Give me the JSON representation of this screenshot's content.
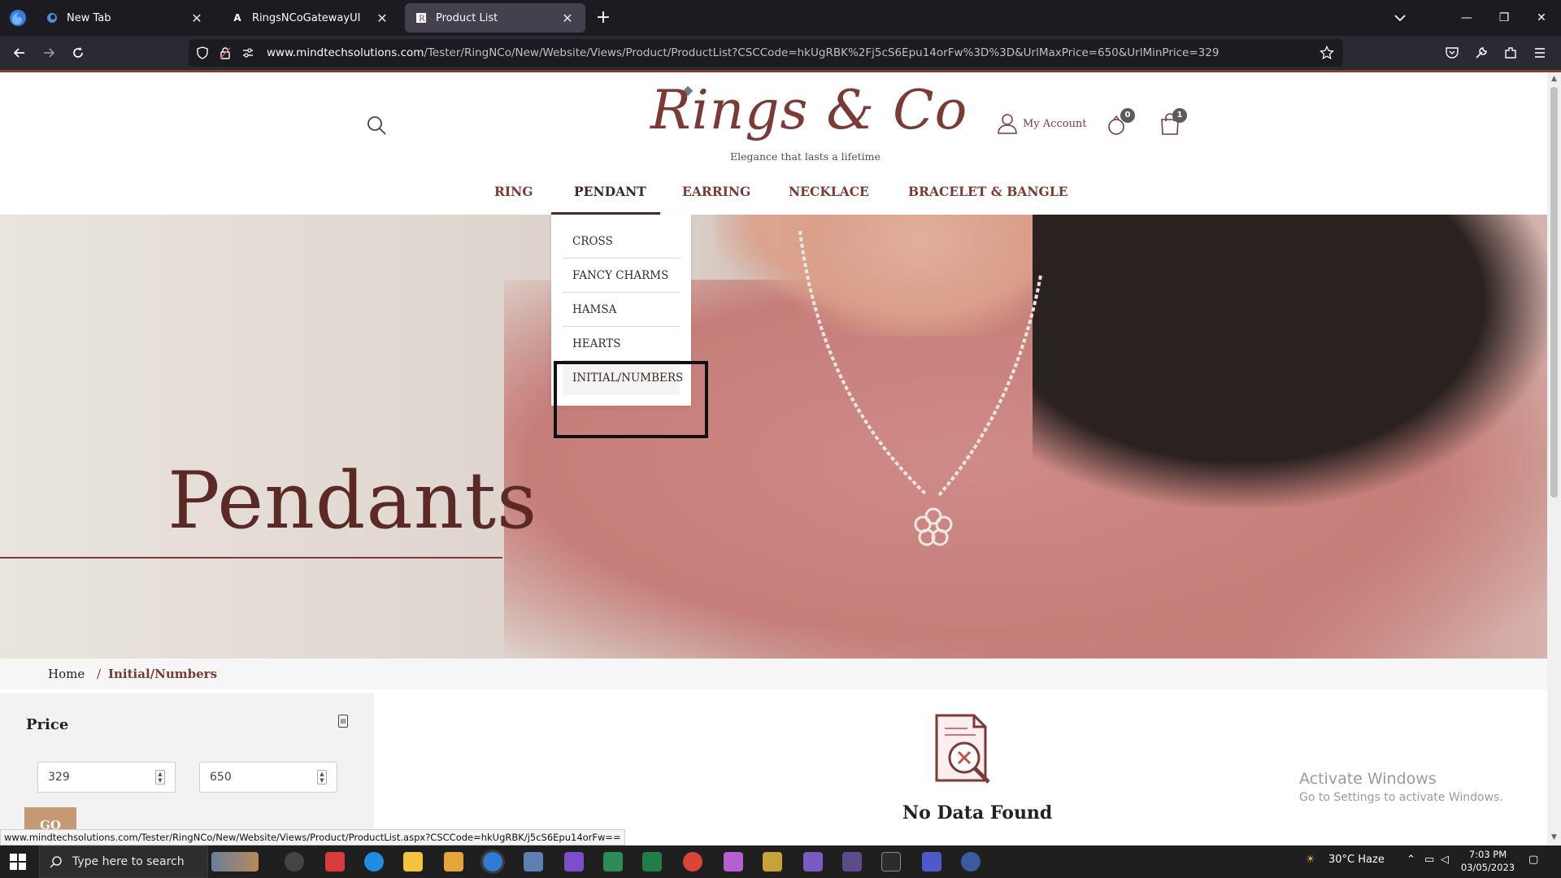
{
  "browser": {
    "tabs": [
      {
        "title": "New Tab"
      },
      {
        "title": "RingsNCoGatewayUI"
      },
      {
        "title": "Product List"
      }
    ],
    "url_domain": "www.mindtechsolutions.com",
    "url_path": "/Tester/RingNCo/New/Website/Views/Product/ProductList?CSCCode=hkUgRBK%2Fj5cS6Epu14orFw%3D%3D&UrlMaxPrice=650&UrlMinPrice=329",
    "status_url": "www.mindtechsolutions.com/Tester/RingNCo/New/Website/Views/Product/ProductList.aspx?CSCCode=hkUgRBK/j5cS6Epu14orFw=="
  },
  "header": {
    "logo_text": "Rings & Co",
    "tagline": "Elegance that lasts a lifetime",
    "account_label": "My Account",
    "wishlist_count": "0",
    "cart_count": "1"
  },
  "nav": {
    "items": [
      "RING",
      "PENDANT",
      "EARRING",
      "NECKLACE",
      "BRACELET & BANGLE"
    ],
    "active": "PENDANT"
  },
  "dropdown": {
    "items": [
      "CROSS",
      "FANCY CHARMS",
      "HAMSA",
      "HEARTS",
      "INITIAL/NUMBERS"
    ]
  },
  "hero": {
    "title": "Pendants"
  },
  "breadcrumb": {
    "home": "Home",
    "separator": "/",
    "current": "Initial/Numbers"
  },
  "filter": {
    "title": "Price",
    "min_value": "329",
    "max_value": "650",
    "go_label": "GO"
  },
  "results": {
    "empty_message": "No Data Found"
  },
  "watermark": {
    "line1": "Activate Windows",
    "line2": "Go to Settings to activate Windows."
  },
  "taskbar": {
    "search_placeholder": "Type here to search",
    "weather": "30°C  Haze",
    "time": "7:03 PM",
    "date": "03/05/2023"
  },
  "colors": {
    "brand": "#7b3a35",
    "go_button": "#c49a74",
    "tabbar_bg": "#1c1b22",
    "navbar_bg": "#2b2a33"
  }
}
